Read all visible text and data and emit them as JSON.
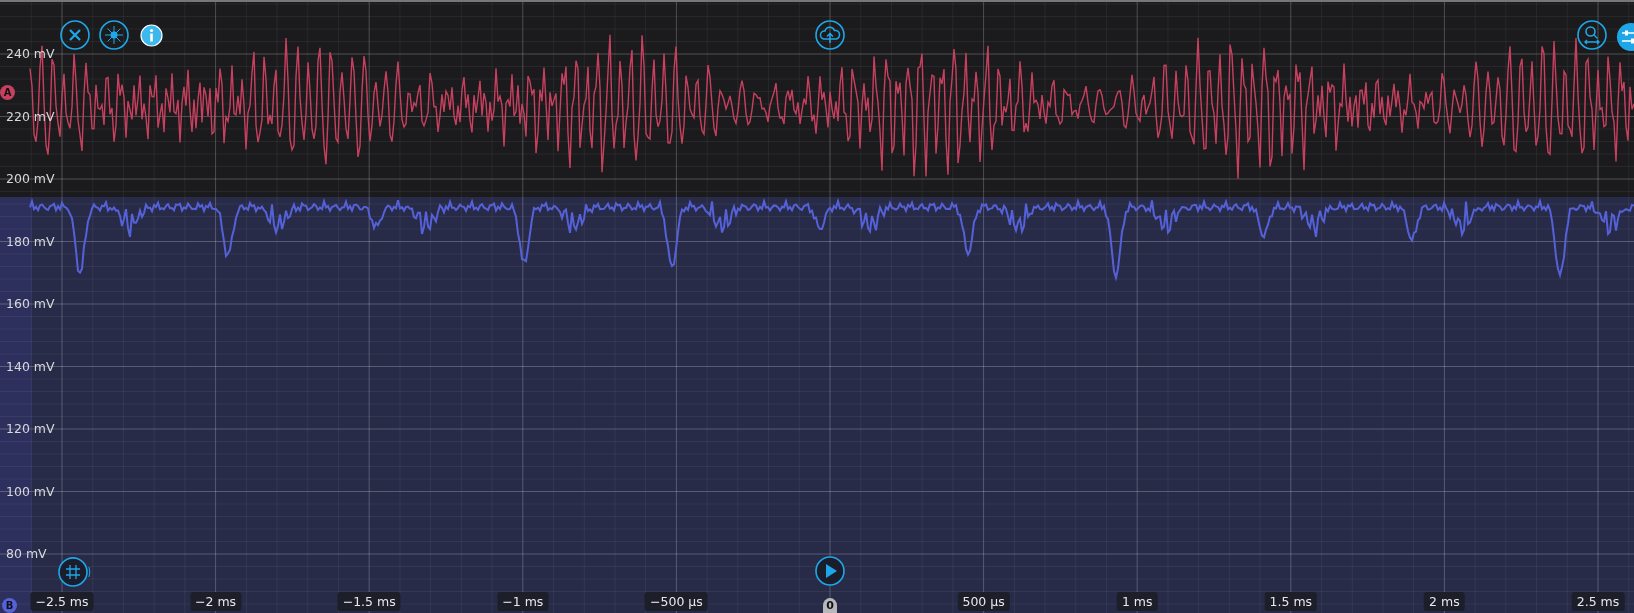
{
  "channels": [
    {
      "label": "A",
      "color": "#c8405f"
    },
    {
      "label": "B",
      "color": "#5561d8"
    }
  ],
  "y_axis": {
    "labels": [
      "240 mV",
      "220 mV",
      "200 mV",
      "180 mV",
      "160 mV",
      "140 mV",
      "120 mV",
      "100 mV",
      "80 mV"
    ]
  },
  "x_axis": {
    "labels": [
      "−2.5 ms",
      "−2 ms",
      "−1.5 ms",
      "−1 ms",
      "−500 µs",
      "500 µs",
      "1 ms",
      "1.5 ms",
      "2 ms",
      "2.5 ms"
    ]
  },
  "trigger": {
    "label": "0"
  }
}
